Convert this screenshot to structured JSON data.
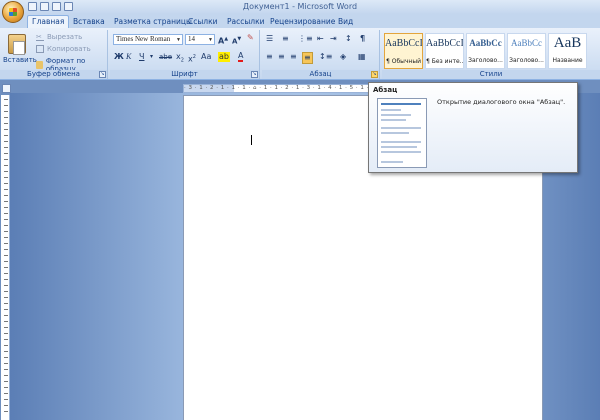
{
  "window": {
    "title": "Документ1 - Microsoft Word"
  },
  "tabs": [
    {
      "label": "Главная",
      "active": true
    },
    {
      "label": "Вставка"
    },
    {
      "label": "Разметка страницы"
    },
    {
      "label": "Ссылки"
    },
    {
      "label": "Рассылки"
    },
    {
      "label": "Рецензирование"
    },
    {
      "label": "Вид"
    }
  ],
  "clipboard": {
    "paste_label": "Вставить",
    "cut_label": "Вырезать",
    "copy_label": "Копировать",
    "format_painter_label": "Формат по образцу",
    "group_label": "Буфер обмена"
  },
  "font": {
    "family": "Times New Roman",
    "size": "14",
    "group_label": "Шрифт"
  },
  "paragraph": {
    "group_label": "Абзац"
  },
  "styles": {
    "group_label": "Стили",
    "items": [
      {
        "sample": "AaBbCcI",
        "name": "¶ Обычный",
        "selected": true
      },
      {
        "sample": "AaBbCcI",
        "name": "¶ Без инте..."
      },
      {
        "sample": "AaBbCc",
        "name": "Заголово..."
      },
      {
        "sample": "AaBbCc",
        "name": "Заголово..."
      },
      {
        "sample": "AaB",
        "name": "Название"
      }
    ]
  },
  "ruler": {
    "text": "· 3 · 1 · 2 · 1 · 1 · 1 · ⌂ · 1 · 1 · 2 · 1 · 3 · 1 · 4 · 1 · 5 · 1 · 6 · 1 · 7 · 1 · 8 · 1 ·"
  },
  "tooltip": {
    "title": "Абзац",
    "description": "Открытие диалогового окна \"Абзац\"."
  },
  "colors": {
    "accent": "#15428b",
    "ribbon": "#dfe9f5",
    "workspace": "#8fb0da",
    "selected_style": "#fff4d2"
  }
}
